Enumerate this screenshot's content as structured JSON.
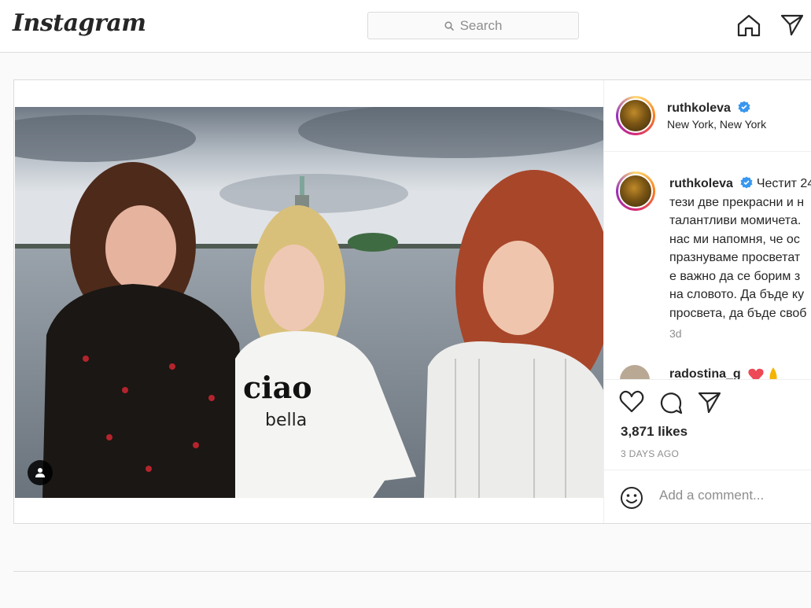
{
  "header": {
    "logo_text": "Instagram",
    "search_placeholder": "Search"
  },
  "post": {
    "username": "ruthkoleva",
    "location": "New York, New York",
    "caption_lines": [
      "Честит 24",
      "тези две прекрасни и н",
      "талантливи момичета.",
      "нас ми напомня, че ос",
      "празнуваме просветат",
      "е важно да се борим з",
      "на словото. Да бъде ку",
      "просвета, да бъде своб"
    ],
    "caption_time": "3d",
    "next_commenter": "radostina_g",
    "likes": "3,871 likes",
    "posted_ago": "3 DAYS AGO",
    "comment_placeholder": "Add a comment..."
  },
  "colors": {
    "verified": "#3897f0",
    "heart_emoji": "#ed4956",
    "border": "#dbdbdb",
    "muted_text": "#8e8e8e"
  },
  "icons": {
    "home": "home-icon",
    "direct": "paper-plane-icon",
    "search": "search-icon",
    "like": "heart-icon",
    "comment": "comment-bubble-icon",
    "share": "paper-plane-icon",
    "emoji": "smiley-icon",
    "tags": "user-tag-icon",
    "verified": "verified-badge-icon"
  }
}
